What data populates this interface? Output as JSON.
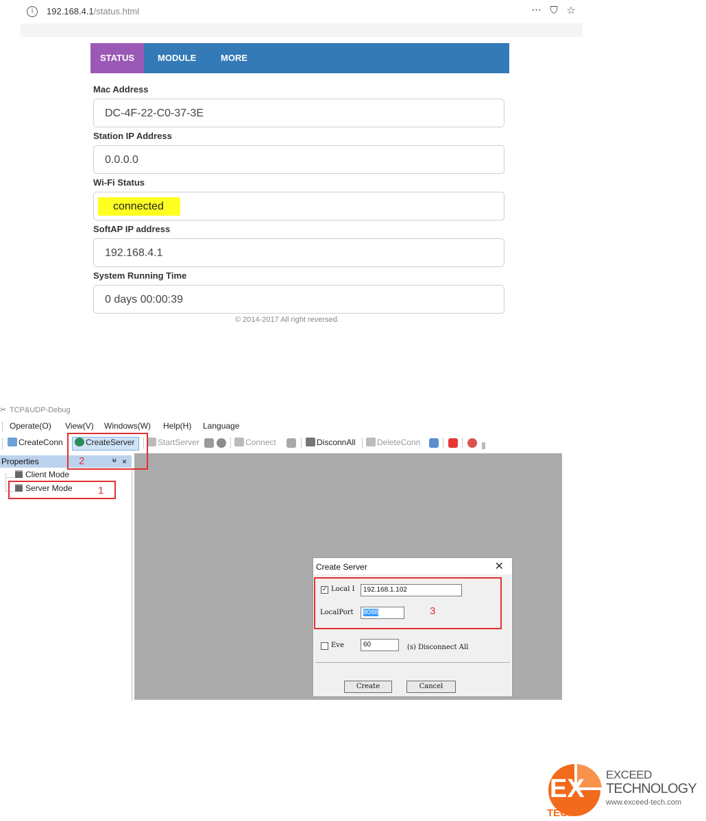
{
  "browser": {
    "url_host": "192.168.4.1",
    "url_path": "/status.html",
    "info_glyph": "i",
    "menu_glyph": "···",
    "pocket_glyph": "⛉",
    "star_glyph": "☆"
  },
  "status_page": {
    "tabs": [
      {
        "label": "STATUS",
        "active": true
      },
      {
        "label": "MODULE",
        "active": false
      },
      {
        "label": "MORE",
        "active": false
      }
    ],
    "fields": [
      {
        "label": "Mac Address",
        "value": "DC-4F-22-C0-37-3E"
      },
      {
        "label": "Station IP Address",
        "value": "0.0.0.0"
      },
      {
        "label": "Wi-Fi Status",
        "value": "connected",
        "highlight": "#ffff22"
      },
      {
        "label": "SoftAP IP address",
        "value": "192.168.4.1"
      },
      {
        "label": "System Running Time",
        "value": "0 days 00:00:39"
      }
    ],
    "footer": "© 2014-2017 All right reversed.",
    "colors": {
      "nav": "#337ab7",
      "active_tab": "#9b59b6"
    }
  },
  "tcp_app": {
    "title": "TCP&UDP-Debug",
    "menu": [
      "Operate(O)",
      "View(V)",
      "Windows(W)",
      "Help(H)",
      "Language"
    ],
    "toolbar": {
      "create_conn": "CreateConn",
      "create_server": "CreateServer",
      "start_server": "StartServer",
      "connect": "Connect",
      "disconn_all": "DisconnAll",
      "delete_conn": "DeleteConn"
    },
    "panel": {
      "title": "Properties",
      "pin_glyph": "ᵾ",
      "close_glyph": "×",
      "items": [
        "Client Mode",
        "Server Mode"
      ]
    },
    "annotations": [
      "1",
      "2",
      "3"
    ],
    "dialog": {
      "title": "Create Server",
      "close_glyph": "✕",
      "local_ip_label": "Local I",
      "local_ip_value": "192.168.1.102",
      "local_ip_checked": true,
      "local_port_label": "LocalPort",
      "local_port_value": "8088",
      "every_label": "Eve",
      "every_checked": false,
      "every_value": "60",
      "every_suffix": "(s) Disconnect All",
      "create_label": "Create",
      "cancel_label": "Cancel"
    }
  },
  "logo": {
    "mark_text": "EX",
    "mark_sub": "TECH",
    "line1": "EXCEED",
    "line2": "TECHNOLOGY",
    "url": "www.exceed-tech.com",
    "color": "#f26a1b"
  }
}
